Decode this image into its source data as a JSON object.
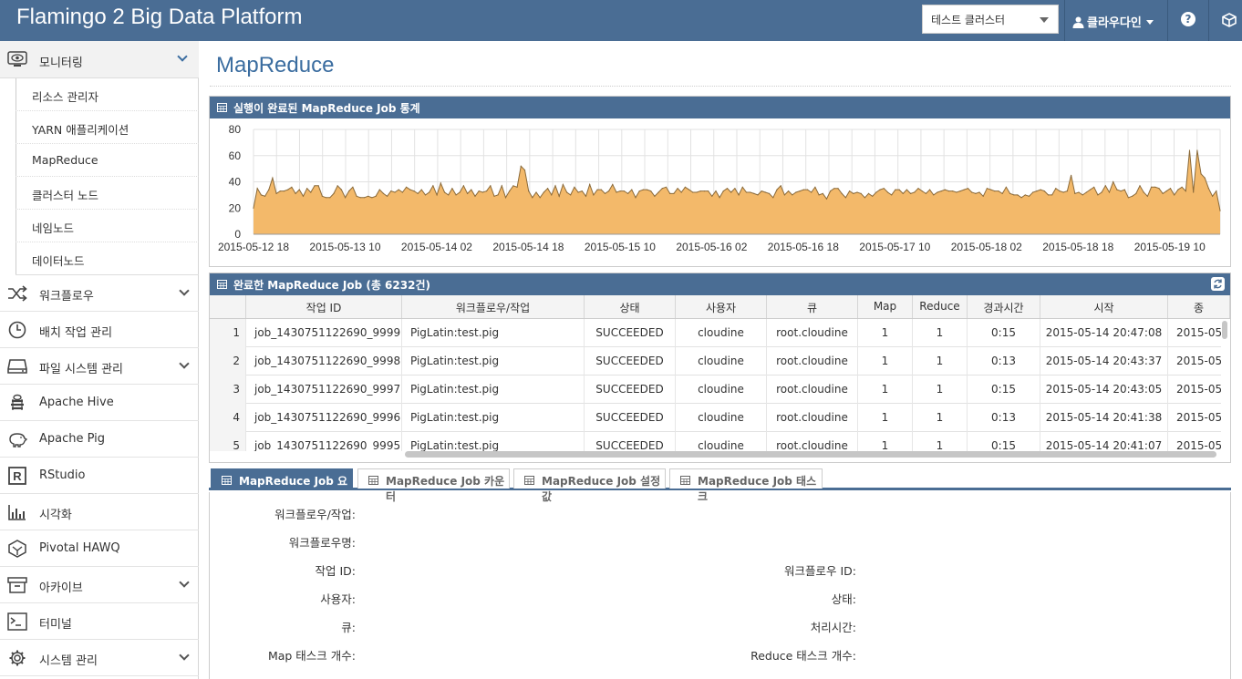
{
  "app": {
    "brand": "Flamingo 2 Big Data Platform",
    "cluster_selected": "테스트 클러스터",
    "user_name": "클라우다인"
  },
  "sidebar": {
    "items": [
      {
        "label": "모니터링",
        "icon": "eye-icon",
        "expandable": true
      },
      {
        "label": "워크플로우",
        "icon": "shuffle-icon",
        "expandable": true
      },
      {
        "label": "배치 작업 관리",
        "icon": "clock-icon",
        "expandable": false
      },
      {
        "label": "파일 시스템 관리",
        "icon": "hard-drive-icon",
        "expandable": true
      },
      {
        "label": "Apache Hive",
        "icon": "hive-icon",
        "expandable": false
      },
      {
        "label": "Apache Pig",
        "icon": "pig-icon",
        "expandable": false
      },
      {
        "label": "RStudio",
        "icon": "r-icon",
        "expandable": false
      },
      {
        "label": "시각화",
        "icon": "bar-chart-icon",
        "expandable": false
      },
      {
        "label": "Pivotal HAWQ",
        "icon": "hawq-icon",
        "expandable": false
      },
      {
        "label": "아카이브",
        "icon": "archive-icon",
        "expandable": true
      },
      {
        "label": "터미널",
        "icon": "terminal-icon",
        "expandable": false
      },
      {
        "label": "시스템 관리",
        "icon": "gear-icon",
        "expandable": true
      }
    ],
    "monitoring_sub": [
      "리소스 관리자",
      "YARN 애플리케이션",
      "MapReduce",
      "클러스터 노드",
      "네임노드",
      "데이터노드"
    ]
  },
  "main": {
    "title": "MapReduce",
    "chart_panel_title": "실행이 완료된 MapReduce Job 통계",
    "grid_panel_title": "완료한 MapReduce Job (총 6232건)"
  },
  "chart_data": {
    "type": "area",
    "title": "실행이 완료된 MapReduce Job 통계",
    "xlabel": "",
    "ylabel": "",
    "ylim": [
      0,
      80
    ],
    "yticks": [
      0,
      20,
      40,
      60,
      80
    ],
    "xtick_labels": [
      "2015-05-12 18",
      "2015-05-13 10",
      "2015-05-14 02",
      "2015-05-14 18",
      "2015-05-15 10",
      "2015-05-16 02",
      "2015-05-16 18",
      "2015-05-17 10",
      "2015-05-18 02",
      "2015-05-18 18",
      "2015-05-19 10"
    ],
    "grid": true,
    "color": "#f3b96a",
    "line_color": "#8a6a3a",
    "values": [
      20,
      35,
      30,
      29,
      34,
      43,
      31,
      33,
      33,
      34,
      36,
      31,
      34,
      29,
      35,
      32,
      37,
      37,
      29,
      28,
      28,
      31,
      37,
      34,
      28,
      33,
      36,
      29,
      28,
      28,
      29,
      28,
      29,
      34,
      31,
      29,
      33,
      32,
      34,
      32,
      36,
      34,
      33,
      31,
      34,
      30,
      32,
      37,
      30,
      39,
      32,
      30,
      35,
      30,
      32,
      37,
      31,
      34,
      29,
      33,
      32,
      33,
      37,
      29,
      30,
      37,
      28,
      33,
      37,
      36,
      52,
      49,
      33,
      28,
      32,
      28,
      32,
      35,
      30,
      37,
      29,
      38,
      32,
      30,
      36,
      32,
      33,
      29,
      38,
      30,
      34,
      34,
      31,
      33,
      38,
      32,
      33,
      33,
      31,
      34,
      28,
      33,
      34,
      34,
      33,
      29,
      32,
      35,
      36,
      31,
      31,
      35,
      32,
      36,
      34,
      32,
      32,
      33,
      33,
      33,
      29,
      33,
      28,
      33,
      35,
      32,
      35,
      30,
      36,
      32,
      32,
      31,
      30,
      33,
      32,
      31,
      28,
      34,
      37,
      30,
      33,
      30,
      32,
      33,
      34,
      34,
      32,
      36,
      30,
      31,
      27,
      33,
      35,
      35,
      31,
      28,
      33,
      31,
      32,
      31,
      28,
      31,
      29,
      32,
      34,
      35,
      32,
      30,
      34,
      34,
      31,
      34,
      31,
      32,
      35,
      33,
      31,
      34,
      30,
      32,
      33,
      34,
      33,
      33,
      32,
      33,
      34,
      35,
      32,
      31,
      32,
      29,
      35,
      34,
      33,
      33,
      31,
      36,
      31,
      30,
      30,
      28,
      30,
      29,
      32,
      33,
      34,
      33,
      30,
      30,
      35,
      33,
      32,
      33,
      45,
      31,
      32,
      30,
      32,
      34,
      36,
      30,
      32,
      37,
      32,
      40,
      34,
      33,
      34,
      28,
      29,
      31,
      37,
      32,
      29,
      36,
      36,
      35,
      31,
      33,
      35,
      30,
      34,
      36,
      33,
      64,
      32,
      64,
      46,
      43,
      35,
      29,
      33,
      18
    ]
  },
  "table": {
    "columns": [
      "",
      "작업 ID",
      "워크플로우/작업",
      "상태",
      "사용자",
      "큐",
      "Map",
      "Reduce",
      "경과시간",
      "시작",
      "종"
    ],
    "rows": [
      {
        "n": "1",
        "id": "job_1430751122690_9999",
        "wf": "PigLatin:test.pig",
        "status": "SUCCEEDED",
        "user": "cloudine",
        "queue": "root.cloudine",
        "map": "1",
        "reduce": "1",
        "elapsed": "0:15",
        "start": "2015-05-14 20:47:08",
        "end": "2015-05"
      },
      {
        "n": "2",
        "id": "job_1430751122690_9998",
        "wf": "PigLatin:test.pig",
        "status": "SUCCEEDED",
        "user": "cloudine",
        "queue": "root.cloudine",
        "map": "1",
        "reduce": "1",
        "elapsed": "0:13",
        "start": "2015-05-14 20:43:37",
        "end": "2015-05"
      },
      {
        "n": "3",
        "id": "job_1430751122690_9997",
        "wf": "PigLatin:test.pig",
        "status": "SUCCEEDED",
        "user": "cloudine",
        "queue": "root.cloudine",
        "map": "1",
        "reduce": "1",
        "elapsed": "0:15",
        "start": "2015-05-14 20:43:05",
        "end": "2015-05"
      },
      {
        "n": "4",
        "id": "job_1430751122690_9996",
        "wf": "PigLatin:test.pig",
        "status": "SUCCEEDED",
        "user": "cloudine",
        "queue": "root.cloudine",
        "map": "1",
        "reduce": "1",
        "elapsed": "0:13",
        "start": "2015-05-14 20:41:38",
        "end": "2015-05"
      },
      {
        "n": "5",
        "id": "job_1430751122690_9995",
        "wf": "PigLatin:test.pig",
        "status": "SUCCEEDED",
        "user": "cloudine",
        "queue": "root.cloudine",
        "map": "1",
        "reduce": "1",
        "elapsed": "0:15",
        "start": "2015-05-14 20:41:07",
        "end": "2015-05"
      }
    ]
  },
  "tabs": [
    "MapReduce Job 요약",
    "MapReduce Job 카운터",
    "MapReduce Job 설정값",
    "MapReduce Job 태스크"
  ],
  "detail": {
    "left": [
      "워크플로우/작업:",
      "워크플로우명:",
      "작업 ID:",
      "사용자:",
      "큐:",
      "Map 태스크 개수:"
    ],
    "right": [
      "워크플로우 ID:",
      "상태:",
      "처리시간:",
      "Reduce 태스크 개수:"
    ]
  }
}
